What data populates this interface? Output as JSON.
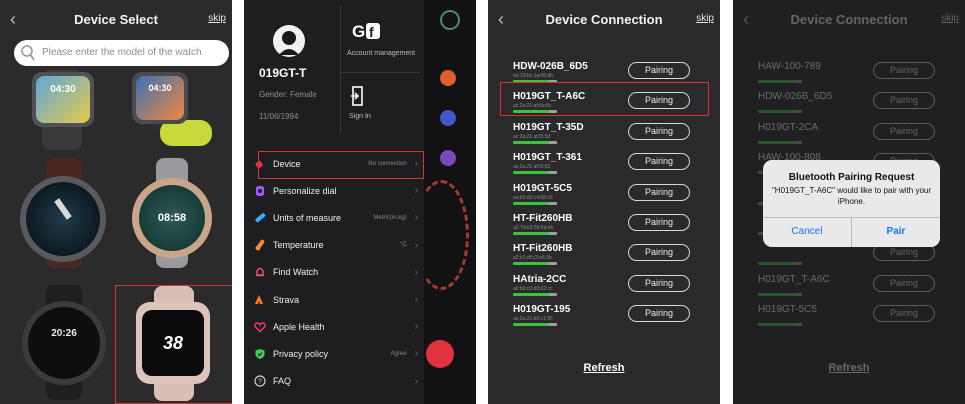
{
  "device_select": {
    "title": "Device Select",
    "skip": "skip",
    "search_placeholder": "Please enter the model of the watch",
    "watch_times": [
      "04:30",
      "04:30",
      "",
      "08:58",
      "20:26",
      "38"
    ]
  },
  "menu_screen": {
    "account_management": "Account management",
    "user_name": "019GT-T",
    "gender": "Gender: Female",
    "birthday": "11/06/1994",
    "sign_in": "Sign In",
    "items": [
      {
        "label": "Device",
        "value": "No connection",
        "icon": "watch-icon",
        "color": "#e8334a"
      },
      {
        "label": "Personalize dial",
        "value": "",
        "icon": "dial-icon",
        "color": "#9b59ff"
      },
      {
        "label": "Units of measure",
        "value": "Metric(m,kg)",
        "icon": "ruler-icon",
        "color": "#32b0ff"
      },
      {
        "label": "Temperature",
        "value": "°C",
        "icon": "thermometer-icon",
        "color": "#f08a3c"
      },
      {
        "label": "Find Watch",
        "value": "",
        "icon": "bell-icon",
        "color": "#ff4f6d"
      },
      {
        "label": "Strava",
        "value": "",
        "icon": "strava-icon",
        "color": "#ff7a1a"
      },
      {
        "label": "Apple Health",
        "value": "",
        "icon": "heart-icon",
        "color": "#ff3b63"
      },
      {
        "label": "Privacy policy",
        "value": "Agree",
        "icon": "shield-icon",
        "color": "#3ecf5a"
      },
      {
        "label": "FAQ",
        "value": "",
        "icon": "question-icon",
        "color": "#d0d0d0"
      }
    ]
  },
  "device_connection": {
    "title": "Device Connection",
    "skip": "skip",
    "pair_label": "Pairing",
    "refresh": "Refresh",
    "devices": [
      {
        "name": "HDW-026B_6D5",
        "mac": "ea:19:bc:1a:06:d5"
      },
      {
        "name": "H019GT_T-A6C",
        "mac": "ac:2a:21:af:6a:6c"
      },
      {
        "name": "H019GT_T-35D",
        "mac": "ac:2a:21:af:f3:5d"
      },
      {
        "name": "H019GT_T-361",
        "mac": "ac:2a:21:af:f3:61"
      },
      {
        "name": "H019GT-5C5",
        "mac": "ea:b1:d1:c4:05:c5"
      },
      {
        "name": "HT-Fit260HB",
        "mac": "a2:7d:e3:5b:5a:eb"
      },
      {
        "name": "HT-Fit260HB",
        "mac": "a2:b1:df:c2:e6:3b"
      },
      {
        "name": "HAtria-2CC",
        "mac": "a0:b0:c0:d0:02:cc"
      },
      {
        "name": "H019GT-195",
        "mac": "ac:2a:21:b0:c1:95"
      }
    ]
  },
  "pairing_request": {
    "title": "Device Connection",
    "skip": "skip",
    "background_devices": [
      "HAW-100-789",
      "HDW-026B_6D5",
      "H019GT-2CA",
      "HAW-100-808",
      "",
      "",
      "",
      "H019GT_T-A6C",
      "H019GT-5C5"
    ],
    "pair_label": "Pairing",
    "refresh": "Refresh",
    "alert_title": "Bluetooth Pairing Request",
    "alert_message": "\"H019GT_T-A6C\" would like to pair with your iPhone.",
    "cancel": "Cancel",
    "pair": "Pair"
  }
}
